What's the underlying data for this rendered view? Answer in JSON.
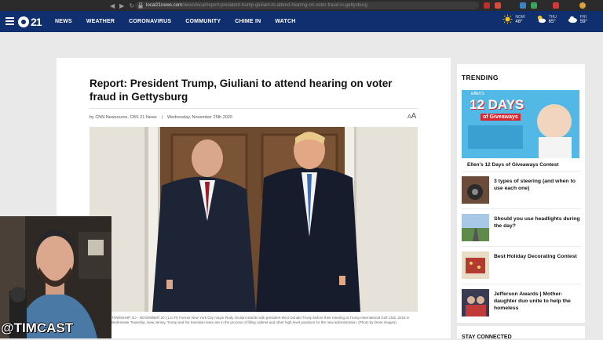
{
  "browser": {
    "url_host": "local21news.com",
    "url_path": "/news/local/report-president-trump-giuliani-to-attend-hearing-on-voter-fraud-in-gettysburg"
  },
  "header": {
    "logo_text": "21",
    "nav": [
      "NEWS",
      "WEATHER",
      "CORONAVIRUS",
      "COMMUNITY",
      "CHIME IN",
      "WATCH"
    ],
    "weather": [
      {
        "day": "NOW",
        "temp": "48°",
        "icon": "sun-icon"
      },
      {
        "day": "THU",
        "temp": "65°",
        "icon": "partly-cloudy-icon"
      },
      {
        "day": "FRI",
        "temp": "59°",
        "icon": "cloud-icon"
      }
    ],
    "colors": {
      "bar": "#0f2f6e"
    }
  },
  "article": {
    "headline": "Report: President Trump, Giuliani to attend hearing on voter fraud in Gettysburg",
    "byline_author": "by CNN Newsource, CBS 21 News",
    "byline_separator": "|",
    "byline_date": "Wednesday, November 25th 2020",
    "font_size_control": "A",
    "caption": "TOWNSHIP, NJ - NOVEMBER 20: (L to R) Former New York City mayor Rudy Giuliani stands with president-elect Donald Trump before their meeting at Trump International Golf Club, 2016 in Bedminster Township, New Jersey. Trump and his transition team are in the process of filling cabinet and other high level positions for the new administration. (Photo by Drew Images)"
  },
  "sidebar": {
    "title": "TRENDING",
    "ad": {
      "brand": "ellen's",
      "headline": "12 DAYS",
      "sub": "of Giveaways"
    },
    "ad_title": "Ellen's 12 Days of Giveaways Contest",
    "items": [
      {
        "title": "3 types of steering (and when to use each one)"
      },
      {
        "title": "Should you use headlights during the day?"
      },
      {
        "title": "Best Holiday Decorating Contest"
      },
      {
        "title": "Jefferson Awards | Mother-daughter duo unite to help the homeless"
      }
    ],
    "next_section": "STAY CONNECTED"
  },
  "overlay": {
    "handle": "@TIMCAST"
  }
}
